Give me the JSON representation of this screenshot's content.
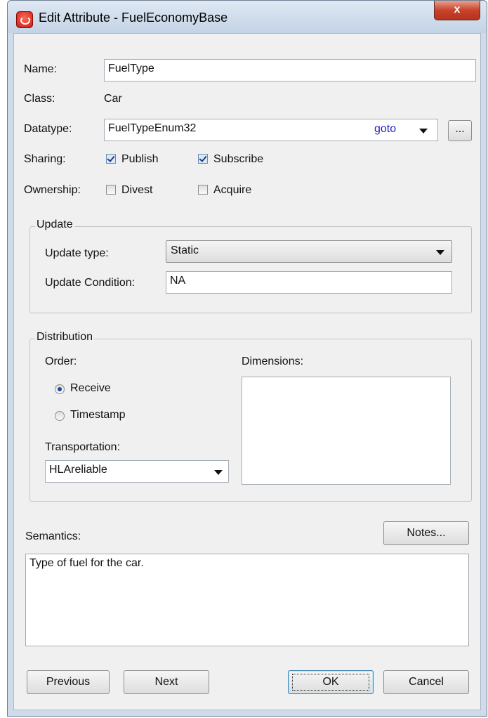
{
  "window": {
    "title": "Edit Attribute - FuelEconomyBase",
    "close_symbol": "x",
    "app_icon": "app-logo-icon"
  },
  "form": {
    "name_label": "Name:",
    "name_value": "FuelType",
    "class_label": "Class:",
    "class_value": "Car",
    "datatype_label": "Datatype:",
    "datatype_value": "FuelTypeEnum32",
    "goto_link": "goto",
    "browse_button": "...",
    "sharing_label": "Sharing:",
    "publish_label": "Publish",
    "publish_checked": true,
    "subscribe_label": "Subscribe",
    "subscribe_checked": true,
    "ownership_label": "Ownership:",
    "divest_label": "Divest",
    "divest_checked": false,
    "acquire_label": "Acquire",
    "acquire_checked": false
  },
  "update": {
    "group_title": "Update",
    "type_label": "Update type:",
    "type_value": "Static",
    "condition_label": "Update Condition:",
    "condition_value": "NA"
  },
  "distribution": {
    "group_title": "Distribution",
    "order_label": "Order:",
    "receive_label": "Receive",
    "timestamp_label": "Timestamp",
    "selected_order": "Receive",
    "transportation_label": "Transportation:",
    "transportation_value": "HLAreliable",
    "dimensions_label": "Dimensions:",
    "dimensions_items": []
  },
  "semantics": {
    "label": "Semantics:",
    "notes_button": "Notes...",
    "text": "Type of fuel for the car."
  },
  "footer": {
    "previous_button": "Previous",
    "next_button": "Next",
    "ok_button": "OK",
    "cancel_button": "Cancel"
  },
  "colors": {
    "link": "#2222cc",
    "close_button": "#c7432c",
    "checkbox_check": "#1d3d86"
  }
}
